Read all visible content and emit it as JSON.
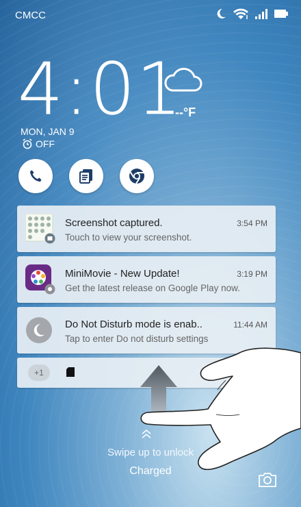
{
  "status_bar": {
    "carrier": "CMCC",
    "icons": [
      "moon-icon",
      "wifi-icon",
      "signal-icon",
      "battery-icon"
    ]
  },
  "lockscreen": {
    "time": "4:01",
    "temperature": "--°F",
    "date": "MON, JAN 9",
    "alarm": "OFF"
  },
  "shortcuts": [
    {
      "name": "phone",
      "icon": "phone-icon"
    },
    {
      "name": "notes",
      "icon": "notes-icon"
    },
    {
      "name": "chrome",
      "icon": "chrome-icon"
    }
  ],
  "notifications": [
    {
      "title": "Screenshot captured.",
      "time": "3:54 PM",
      "text": "Touch to view your screenshot.",
      "icon": "screenshot-thumbnail-icon"
    },
    {
      "title": "MiniMovie - New Update!",
      "time": "3:19 PM",
      "text": "Get the latest release on Google Play now.",
      "icon": "minimovie-icon"
    },
    {
      "title": "Do Not Disturb mode is enab..",
      "time": "11:44 AM",
      "text": "Tap to enter Do not disturb settings",
      "icon": "do-not-disturb-icon"
    }
  ],
  "collapsed": {
    "count": "+1"
  },
  "footer": {
    "swipe_text": "Swipe up to unlock",
    "charged_text": "Charged"
  },
  "colors": {
    "accent_purple": "#6a2b86",
    "wallpaper_blue": "#3f86bf"
  }
}
